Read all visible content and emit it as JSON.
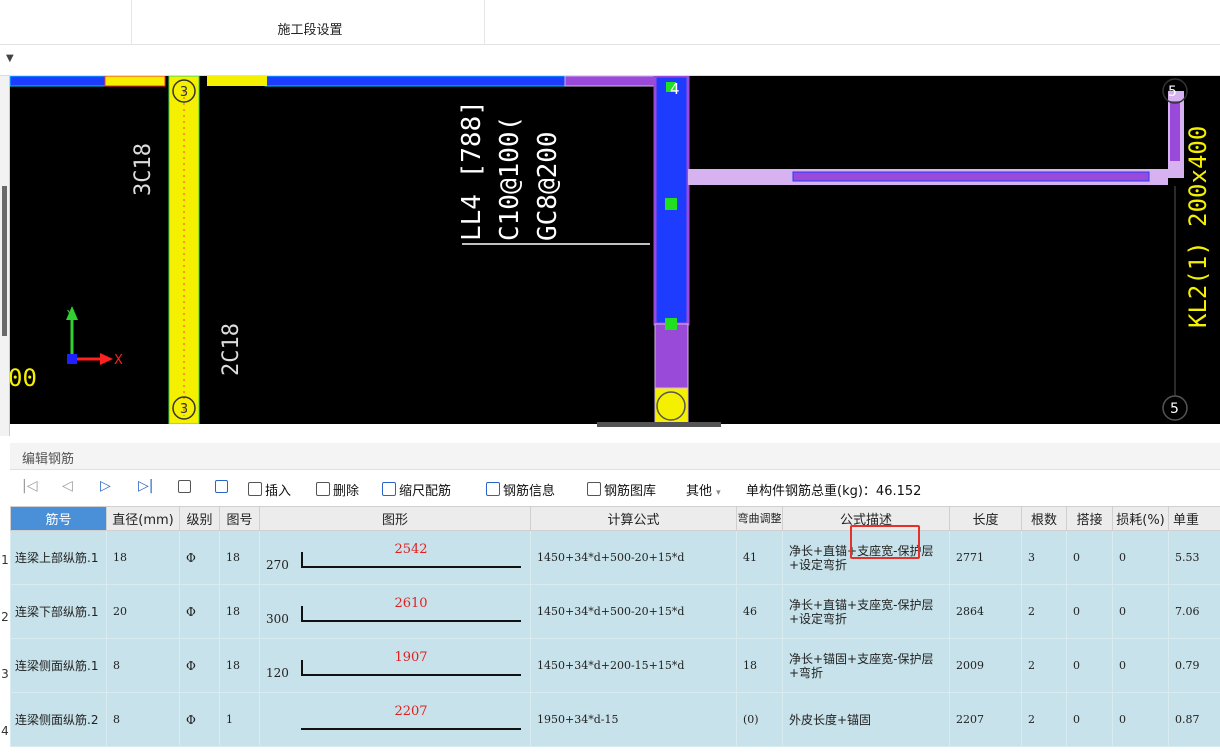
{
  "header": {
    "tab_label": "施工段设置"
  },
  "canvas": {
    "labels": {
      "ll4": "LL4 [788]",
      "c10": "C10@100(",
      "gc8": "GC8@200",
      "left1": "3C18",
      "left2": "2C18",
      "kl2": "KL2(1) 200x400",
      "axis_4": "4",
      "axis_5_top": "5",
      "axis_5_bottom": "5",
      "axis_3_top": "3",
      "axis_3_bottom": "3",
      "axis_left_num": "00",
      "axis_x": "X",
      "axis_y": "Y"
    }
  },
  "panel": {
    "title": "编辑钢筋"
  },
  "toolbar": {
    "insert": "插入",
    "delete": "删除",
    "scale": "缩尺配筋",
    "info": "钢筋信息",
    "library": "钢筋图库",
    "other": "其他",
    "other_arrow": "▾",
    "total": "单构件钢筋总重(kg)：46.152"
  },
  "table": {
    "headers": [
      "筋号",
      "直径(mm)",
      "级别",
      "图号",
      "图形",
      "计算公式",
      "弯曲调整",
      "公式描述",
      "长度",
      "根数",
      "搭接",
      "损耗(%)",
      "单重"
    ],
    "rows": [
      {
        "num": "1",
        "name": "连梁上部纵筋.1",
        "dia": "18",
        "grade": "Φ",
        "fig": "18",
        "shape_left": "270",
        "shape_mid": "2542",
        "formula": "1450+34*d+500-20+15*d",
        "bend": "41",
        "desc": "净长+直锚+支座宽-保护层+设定弯折",
        "len": "2771",
        "count": "3",
        "lap": "0",
        "loss": "0",
        "unit": "5.53"
      },
      {
        "num": "2",
        "name": "连梁下部纵筋.1",
        "dia": "20",
        "grade": "Φ",
        "fig": "18",
        "shape_left": "300",
        "shape_mid": "2610",
        "formula": "1450+34*d+500-20+15*d",
        "bend": "46",
        "desc": "净长+直锚+支座宽-保护层+设定弯折",
        "len": "2864",
        "count": "2",
        "lap": "0",
        "loss": "0",
        "unit": "7.06"
      },
      {
        "num": "3",
        "name": "连梁侧面纵筋.1",
        "dia": "8",
        "grade": "Φ",
        "fig": "18",
        "shape_left": "120",
        "shape_mid": "1907",
        "formula": "1450+34*d+200-15+15*d",
        "bend": "18",
        "desc": "净长+锚固+支座宽-保护层+弯折",
        "len": "2009",
        "count": "2",
        "lap": "0",
        "loss": "0",
        "unit": "0.79"
      },
      {
        "num": "4",
        "name": "连梁侧面纵筋.2",
        "dia": "8",
        "grade": "Φ",
        "fig": "1",
        "shape_left": "",
        "shape_mid": "2207",
        "formula": "1950+34*d-15",
        "bend": "(0)",
        "desc": "外皮长度+锚固",
        "len": "2207",
        "count": "2",
        "lap": "0",
        "loss": "0",
        "unit": "0.87"
      }
    ]
  },
  "colors": {
    "header_highlight": "#4a90d9",
    "row_bg": "#c7e2ea",
    "yellow": "#f5f000",
    "blue": "#1e3cff",
    "purple": "#9a4ad8",
    "lilac": "#d6b3f0"
  }
}
